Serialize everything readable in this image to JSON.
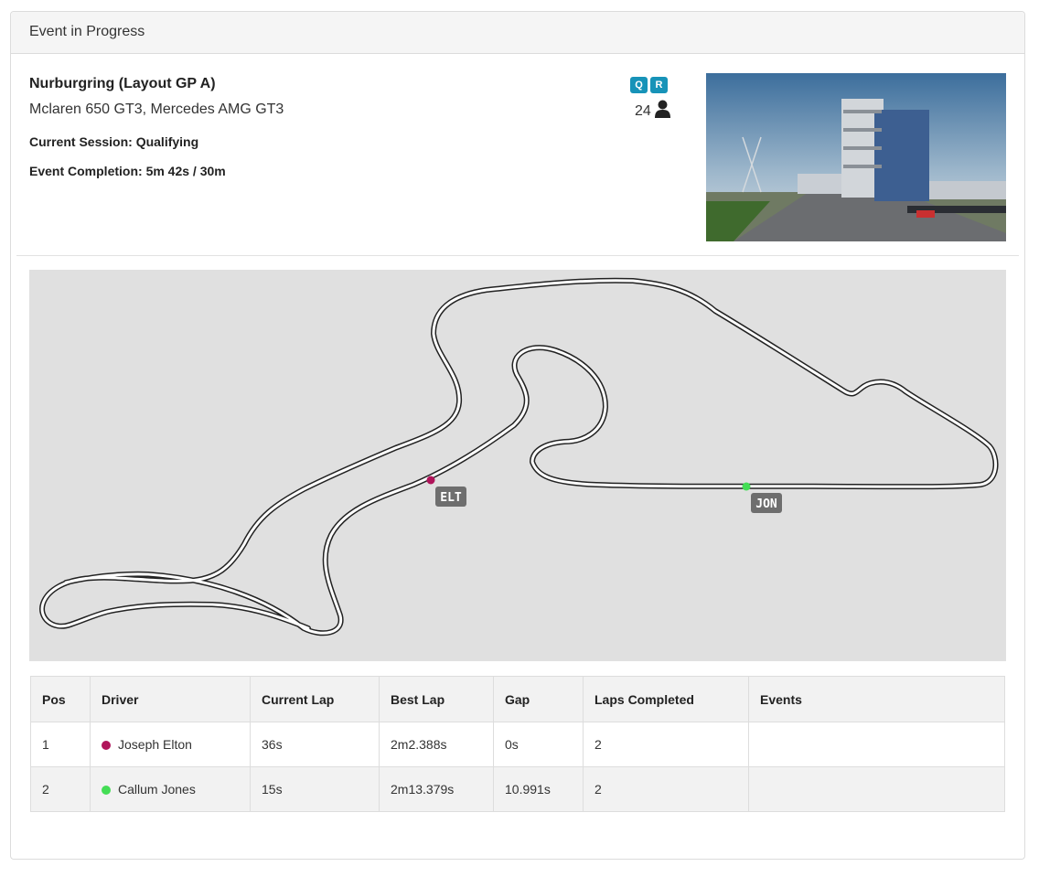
{
  "panel": {
    "title": "Event in Progress"
  },
  "event": {
    "track": "Nurburgring (Layout GP A)",
    "cars": "Mclaren 650 GT3, Mercedes AMG GT3",
    "session_label": "Current Session:",
    "session_value": "Qualifying",
    "completion_label": "Event Completion:",
    "completion_value": "5m 42s / 30m",
    "session_badges": [
      "Q",
      "R"
    ],
    "player_count": "24",
    "player_icon": "user-icon"
  },
  "map": {
    "markers": [
      {
        "label": "ELT",
        "color": "#b0145a"
      },
      {
        "label": "JON",
        "color": "#44dd55"
      }
    ]
  },
  "table": {
    "headers": [
      "Pos",
      "Driver",
      "Current Lap",
      "Best Lap",
      "Gap",
      "Laps Completed",
      "Events"
    ],
    "rows": [
      {
        "pos": "1",
        "driver": "Joseph Elton",
        "color": "#b0145a",
        "current_lap": "36s",
        "best_lap": "2m2.388s",
        "gap": "0s",
        "laps": "2",
        "events": ""
      },
      {
        "pos": "2",
        "driver": "Callum Jones",
        "color": "#44dd55",
        "current_lap": "15s",
        "best_lap": "2m13.379s",
        "gap": "10.991s",
        "laps": "2",
        "events": ""
      }
    ]
  }
}
